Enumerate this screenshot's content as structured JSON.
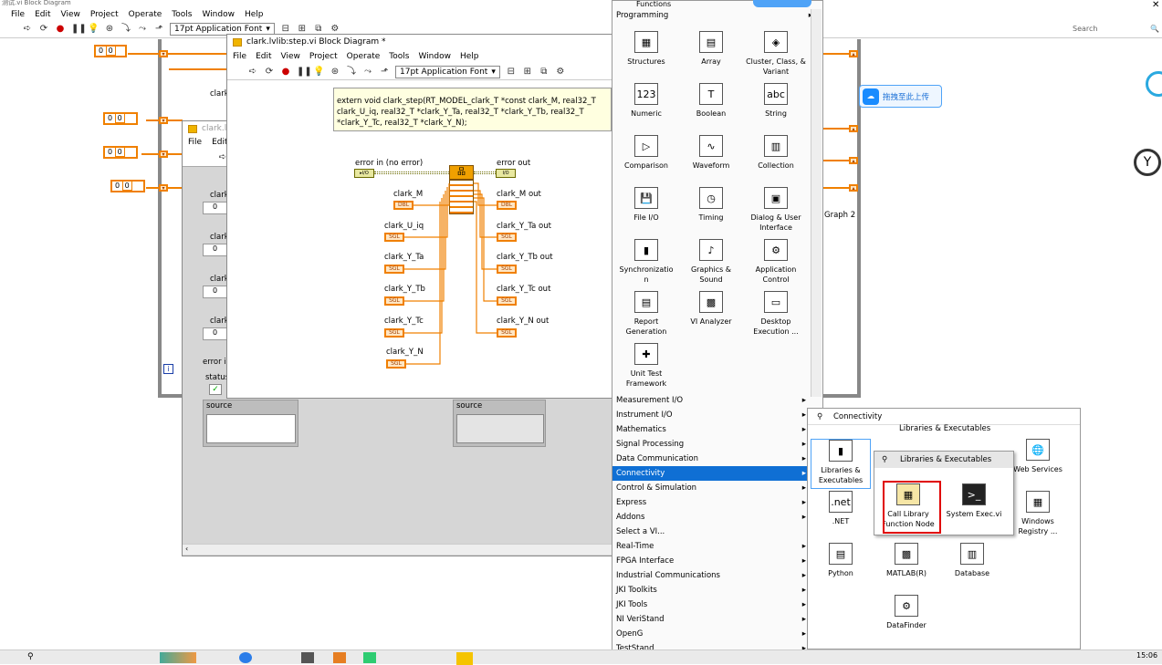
{
  "topbar": {
    "title_fragment": "测试.vi Block Diagram",
    "search_placeholder": "Search"
  },
  "back_menu": [
    "File",
    "Edit",
    "View",
    "Project",
    "Operate",
    "Tools",
    "Window",
    "Help"
  ],
  "back_font": "17pt Application Font",
  "front_panel": {
    "title": "clark.lvli",
    "menu": [
      "File",
      "Edit"
    ],
    "field_labels": [
      "clark",
      "clark",
      "clark",
      "clark"
    ],
    "values": [
      "0",
      "0",
      "0",
      "0"
    ],
    "error_label": "error i",
    "status": "status",
    "source_label": "source",
    "source_label2": "source"
  },
  "block_diagram": {
    "title": "clark.lvlib:step.vi Block Diagram *",
    "menu": [
      "File",
      "Edit",
      "View",
      "Project",
      "Operate",
      "Tools",
      "Window",
      "Help"
    ],
    "font": "17pt Application Font",
    "comment": "extern void clark_step(RT_MODEL_clark_T *const clark_M, real32_T clark_U_iq, real32_T *clark_Y_Ta, real32_T *clark_Y_Tb, real32_T *clark_Y_Tc, real32_T *clark_Y_N);",
    "error_in": "error in (no error)",
    "error_out": "error out",
    "inputs": [
      "clark_M",
      "clark_U_iq",
      "clark_Y_Ta",
      "clark_Y_Tb",
      "clark_Y_Tc",
      "clark_Y_N"
    ],
    "outputs": [
      "clark_M out",
      "clark_Y_Ta out",
      "clark_Y_Tb out",
      "clark_Y_Tc out",
      "clark_Y_N out"
    ],
    "types": {
      "dbl": "DBL",
      "sgl": "SGL"
    }
  },
  "back_labels": {
    "clark_top": "clark",
    "graph": "Graph 2"
  },
  "back_values": [
    "0",
    "0",
    "0",
    "0",
    "0",
    "0",
    "0",
    "0"
  ],
  "functions_palette": {
    "header": "Functions",
    "category": "Programming",
    "items": [
      {
        "label": "Structures",
        "icon": "▦"
      },
      {
        "label": "Array",
        "icon": "▤"
      },
      {
        "label": "Cluster, Class, & Variant",
        "icon": "◈"
      },
      {
        "label": "Numeric",
        "icon": "123"
      },
      {
        "label": "Boolean",
        "icon": "T"
      },
      {
        "label": "String",
        "icon": "abc"
      },
      {
        "label": "Comparison",
        "icon": "▷"
      },
      {
        "label": "Waveform",
        "icon": "∿"
      },
      {
        "label": "Collection",
        "icon": "▥"
      },
      {
        "label": "File I/O",
        "icon": "💾"
      },
      {
        "label": "Timing",
        "icon": "◷"
      },
      {
        "label": "Dialog & User Interface",
        "icon": "▣"
      },
      {
        "label": "Synchronizatio n",
        "icon": "▮"
      },
      {
        "label": "Graphics & Sound",
        "icon": "♪"
      },
      {
        "label": "Application Control",
        "icon": "⚙"
      },
      {
        "label": "Report Generation",
        "icon": "▤"
      },
      {
        "label": "VI Analyzer",
        "icon": "▩"
      },
      {
        "label": "Desktop Execution ...",
        "icon": "▭"
      },
      {
        "label": "Unit Test Framework",
        "icon": "✚"
      }
    ],
    "categories": [
      "Measurement I/O",
      "Instrument I/O",
      "Mathematics",
      "Signal Processing",
      "Data Communication",
      "Connectivity",
      "Control & Simulation",
      "Express",
      "Addons",
      "Select a VI...",
      "Real-Time",
      "FPGA Interface",
      "Industrial Communications",
      "JKI Toolkits",
      "JKI Tools",
      "NI VeriStand",
      "OpenG",
      "TestStand"
    ],
    "selected_category": "Connectivity"
  },
  "connectivity": {
    "header": "Connectivity",
    "top_label": "Libraries & Executables",
    "items": [
      {
        "label": "Libraries & Executables",
        "icon": "▮"
      },
      {
        "label": "Web Services",
        "icon": "🌐"
      },
      {
        "label": ".NET",
        "icon": ".net"
      },
      {
        "label": "Windows Registry ...",
        "icon": "▦"
      },
      {
        "label": "Python",
        "icon": "▤"
      },
      {
        "label": "MATLAB(R)",
        "icon": "▩"
      },
      {
        "label": "Database",
        "icon": "▥"
      },
      {
        "label": "DataFinder",
        "icon": "⚙"
      }
    ]
  },
  "libraries": {
    "header": "Libraries & Executables",
    "items": [
      {
        "label": "Call Library Function Node",
        "icon": "▦"
      },
      {
        "label": "System Exec.vi",
        "icon": ">_"
      }
    ]
  },
  "upload_button": "拖拽至此上传",
  "clock": "15:06"
}
